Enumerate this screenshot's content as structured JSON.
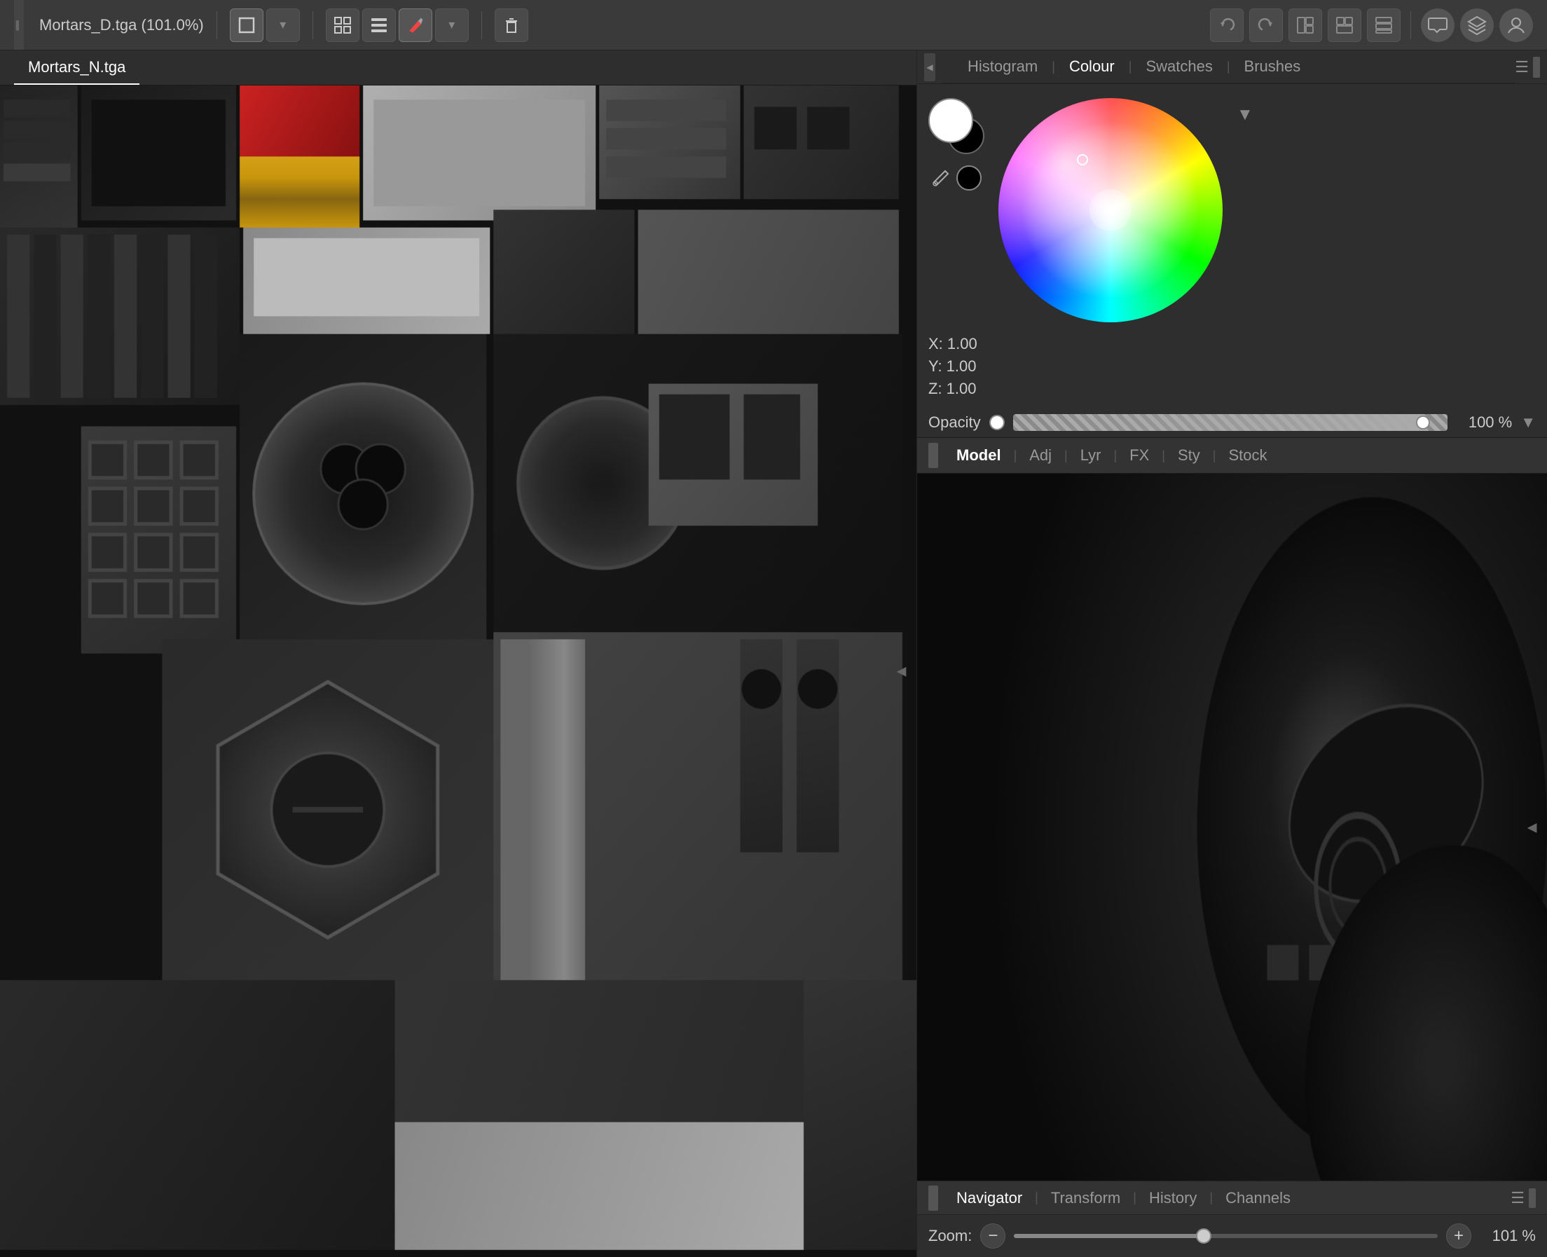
{
  "app": {
    "title": "Mortars_D.tga (101.0%)"
  },
  "toolbar": {
    "title": "Mortars_D.tga (101.0%)",
    "zoom_percent": "101.0%",
    "buttons": [
      "square-tool",
      "grid-tool",
      "brush-tool",
      "dropdown",
      "trash-tool"
    ]
  },
  "canvas_tab": {
    "label": "Mortars_N.tga"
  },
  "right_panel": {
    "color_tabs": [
      {
        "label": "Histogram",
        "active": false
      },
      {
        "label": "Colour",
        "active": true
      },
      {
        "label": "Swatches",
        "active": false
      },
      {
        "label": "Brushes",
        "active": false
      }
    ],
    "color_wheel": {
      "x": "X: 1.00",
      "y": "Y: 1.00",
      "z": "Z: 1.00"
    },
    "opacity": {
      "label": "Opacity",
      "value": "100 %"
    },
    "layer_tabs": [
      {
        "label": "Model",
        "active": true
      },
      {
        "label": "Adj",
        "active": false
      },
      {
        "label": "Lyr",
        "active": false
      },
      {
        "label": "FX",
        "active": false
      },
      {
        "label": "Sty",
        "active": false
      },
      {
        "label": "Stock",
        "active": false
      }
    ],
    "navigator_tabs": [
      {
        "label": "Navigator",
        "active": true
      },
      {
        "label": "Transform",
        "active": false
      },
      {
        "label": "History",
        "active": false
      },
      {
        "label": "Channels",
        "active": false
      }
    ],
    "zoom": {
      "label": "Zoom:",
      "value": "101 %"
    }
  }
}
